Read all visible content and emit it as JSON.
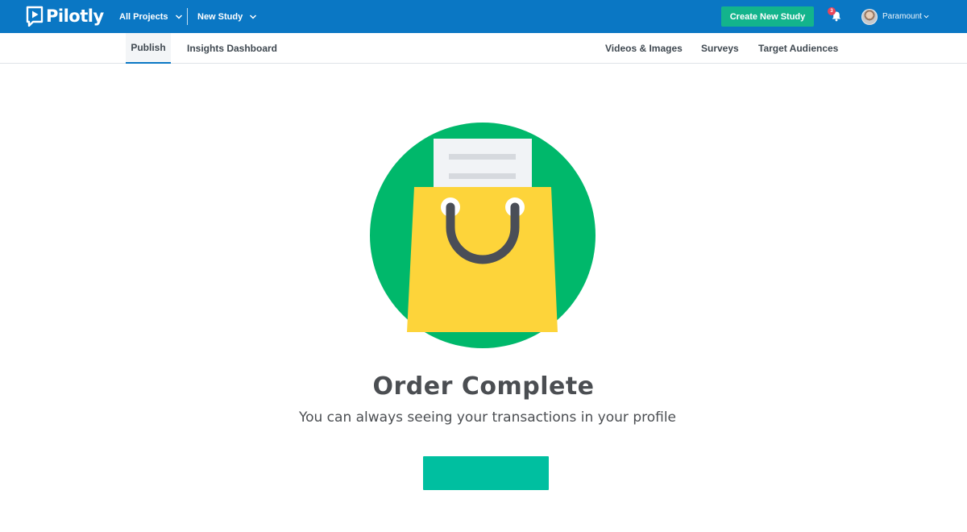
{
  "brand": {
    "name": "Pilotly",
    "primary_color": "#0a77c4",
    "accent_color": "#13b48c"
  },
  "topbar": {
    "all_projects_label": "All Projects",
    "new_study_label": "New Study",
    "create_button_label": "Create New Study",
    "notification_count": "3",
    "user_name": "Paramount"
  },
  "subnav": {
    "left_tabs": [
      "Publish",
      "Insights Dashboard"
    ],
    "right_tabs": [
      "Videos & Images",
      "Surveys",
      "Target Audiences"
    ],
    "active_tab": "Publish"
  },
  "main": {
    "icon": "shopping-bag-icon",
    "title": "Order Complete",
    "subtitle": "You can always seeing your transactions in your profile",
    "button_label": "",
    "illustration_colors": {
      "circle": "#00b86b",
      "bag": "#fdd43a",
      "handle": "#4a4e57",
      "receipt": "#f1f3f6"
    },
    "button_color": "#00bfa0"
  }
}
